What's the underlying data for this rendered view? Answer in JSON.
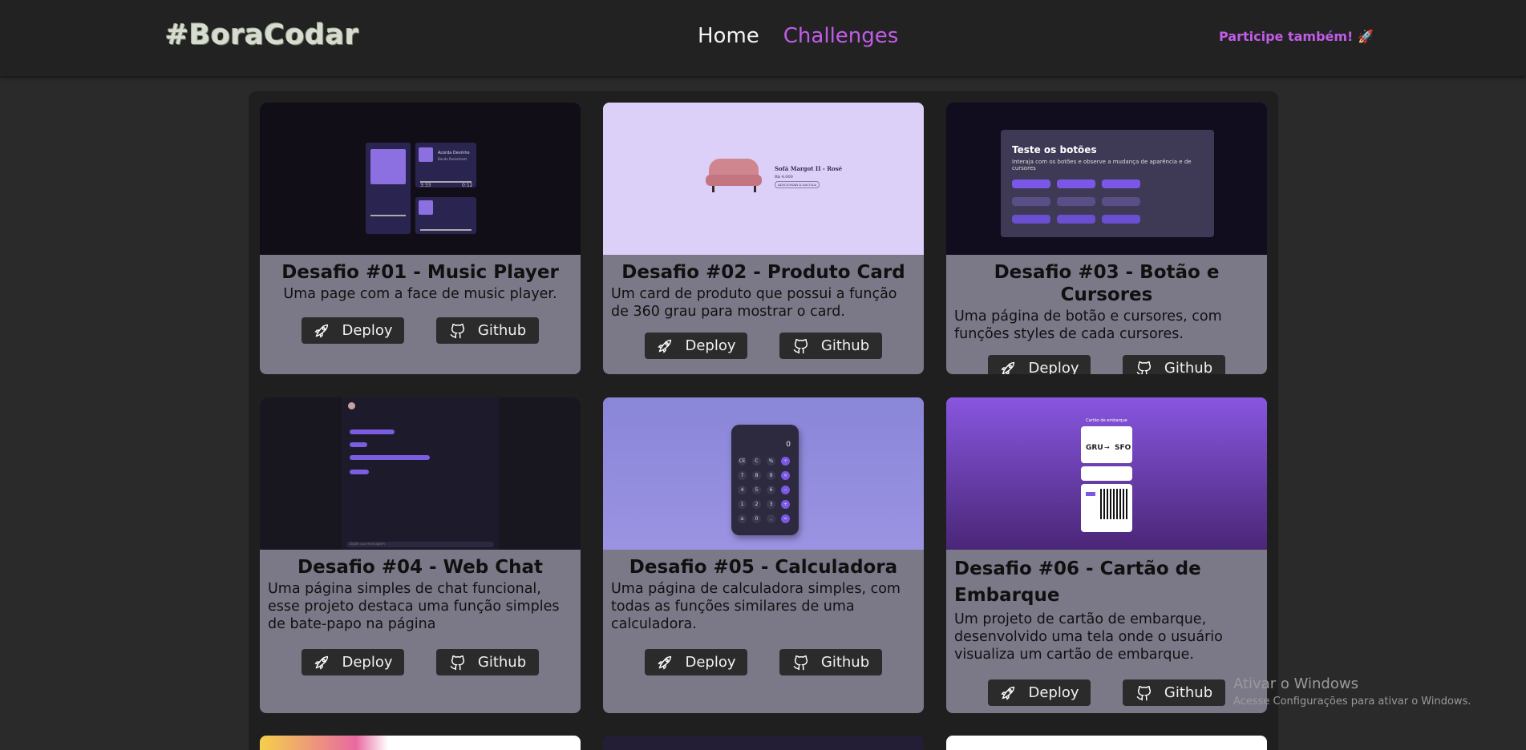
{
  "header": {
    "logo": "#BoraCodar",
    "nav": {
      "home": "Home",
      "challenges": "Challenges"
    },
    "cta": "Participe também!",
    "cta_icon": "rocket-emoji"
  },
  "colors": {
    "accent": "#c15ce8",
    "card_bg": "#7b7988",
    "button_bg": "#2b2b2b",
    "page_bg": "#2a2a2a"
  },
  "cards": [
    {
      "title": "Desafio #01 - Music Player",
      "desc": "Uma page com a face de music player.",
      "deploy": "Deploy",
      "github": "Github",
      "thumb": {
        "artist": "Acorda Devinho",
        "band": "Banda Rocketseat",
        "t_start": "3:33",
        "t_end": "0:12"
      }
    },
    {
      "title": "Desafio #02 - Produto Card",
      "desc": "Um card de produto que possui a função de 360 grau para mostrar o card.",
      "deploy": "Deploy",
      "github": "Github",
      "thumb": {
        "name": "Sofá Margot II - Rosé",
        "price": "R$ 4.000",
        "btn": "ADICIONAR À SACOLA"
      }
    },
    {
      "title": "Desafio #03 - Botão e Cursores",
      "desc": "Uma página de botão e cursores, com funções styles de cada cursores.",
      "deploy": "Deploy",
      "github": "Github",
      "thumb": {
        "heading": "Teste os botões",
        "sub": "Interaja com os botões e observe a mudança de aparência e de cursores"
      }
    },
    {
      "title": "Desafio #04 - Web Chat",
      "desc": "Uma página simples de chat funcional, esse projeto destaca uma função simples de bate-papo na página",
      "deploy": "Deploy",
      "github": "Github",
      "thumb": {
        "placeholder": "Digite sua mensagem"
      }
    },
    {
      "title": "Desafio #05 - Calculadora",
      "desc": "Uma página de calculadora simples, com todas as funções similares de uma calculadora.",
      "deploy": "Deploy",
      "github": "Github",
      "thumb": {
        "display": "0",
        "keys": [
          "CE",
          "C",
          "%",
          "÷",
          "7",
          "8",
          "9",
          "×",
          "4",
          "5",
          "6",
          "−",
          "1",
          "2",
          "3",
          "+",
          "±",
          "0",
          ",",
          "="
        ]
      }
    },
    {
      "title": "Desafio #06 - Cartão de Embarque",
      "desc": "Um projeto de cartão de embarque, desenvolvido uma tela onde o usuário visualiza um cartão de embarque.",
      "deploy": "Deploy",
      "github": "Github",
      "thumb": {
        "heading": "Cartão de embarque",
        "from": "GRU",
        "to": "SFO"
      }
    }
  ],
  "watermark": {
    "line1": "Ativar o Windows",
    "line2": "Acesse Configurações para ativar o Windows."
  }
}
